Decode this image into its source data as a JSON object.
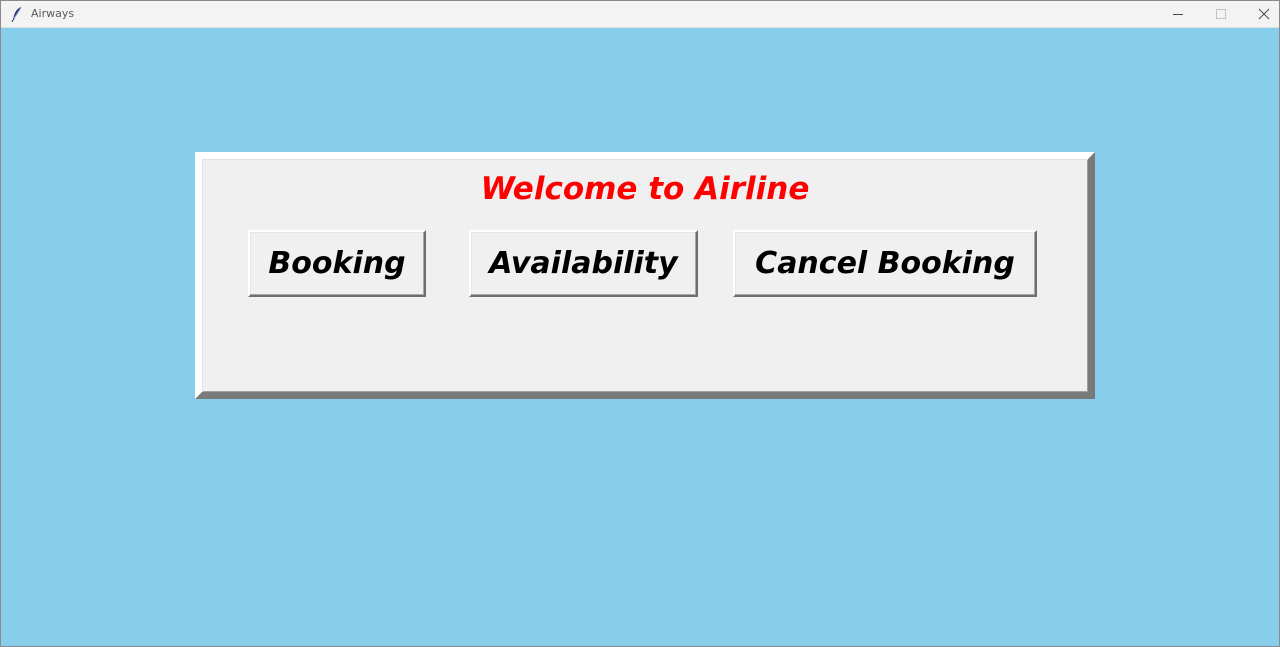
{
  "window": {
    "title": "Airways",
    "icon": "feather-icon",
    "background": "#87CEEB"
  },
  "titlebar_controls": [
    "minimize-icon",
    "maximize-icon",
    "close-icon"
  ],
  "main": {
    "welcome_text": "Welcome to Airline",
    "welcome_color": "#ff0000",
    "buttons": [
      {
        "label": "Booking"
      },
      {
        "label": "Availability"
      },
      {
        "label": "Cancel Booking"
      }
    ]
  }
}
